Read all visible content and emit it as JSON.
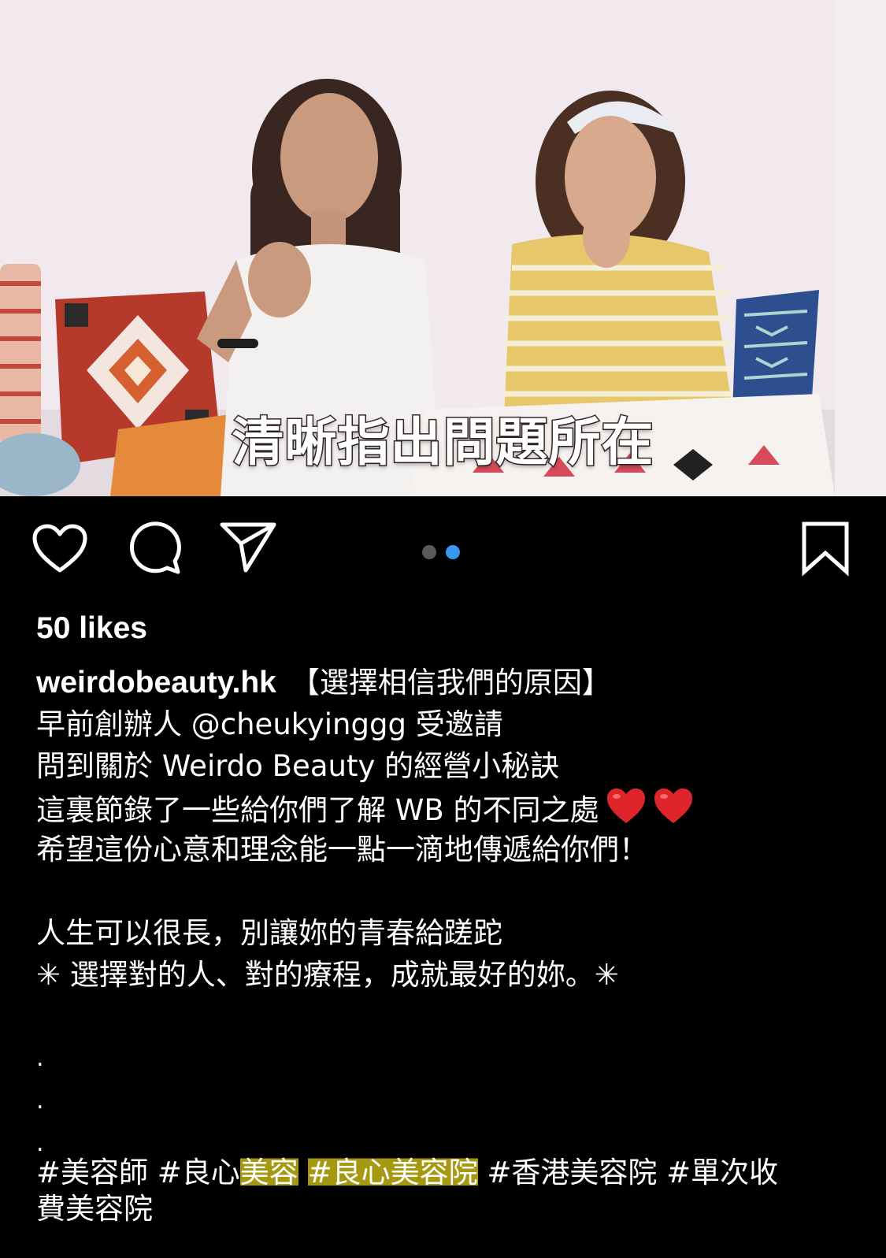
{
  "media": {
    "subtitle": "清晰指出問題所在"
  },
  "actions": {
    "like_icon": "heart-outline-icon",
    "comment_icon": "comment-bubble-icon",
    "share_icon": "paper-plane-icon",
    "save_icon": "bookmark-outline-icon",
    "carousel": {
      "count": 2,
      "active_index": 1,
      "active_color": "#3897f0",
      "inactive_color": "#5a5a5a"
    }
  },
  "post": {
    "likes": "50 likes",
    "username": "weirdobeauty.hk",
    "caption_lines": [
      "【選擇相信我們的原因】",
      "早前創辦人 @cheukyinggg 受邀請",
      "問到關於 Weirdo Beauty 的經營小秘訣",
      "這裏節錄了一些給你們了解 WB 的不同之處",
      "希望這份心意和理念能一點一滴地傳遞給你們！",
      "人生可以很長，別讓妳的青春給蹉跎",
      "✳︎ 選擇對的人、對的療程，成就最好的妳。✳︎"
    ],
    "dots": [
      ".",
      ".",
      "."
    ],
    "hashtags": [
      "#美容師",
      "#良心",
      "美容",
      "#良心美容院",
      "#香港美容院",
      "#單次收",
      "費美容院"
    ]
  },
  "colors": {
    "background": "#000000",
    "text": "#ffffff",
    "highlight": "#c4b214"
  }
}
